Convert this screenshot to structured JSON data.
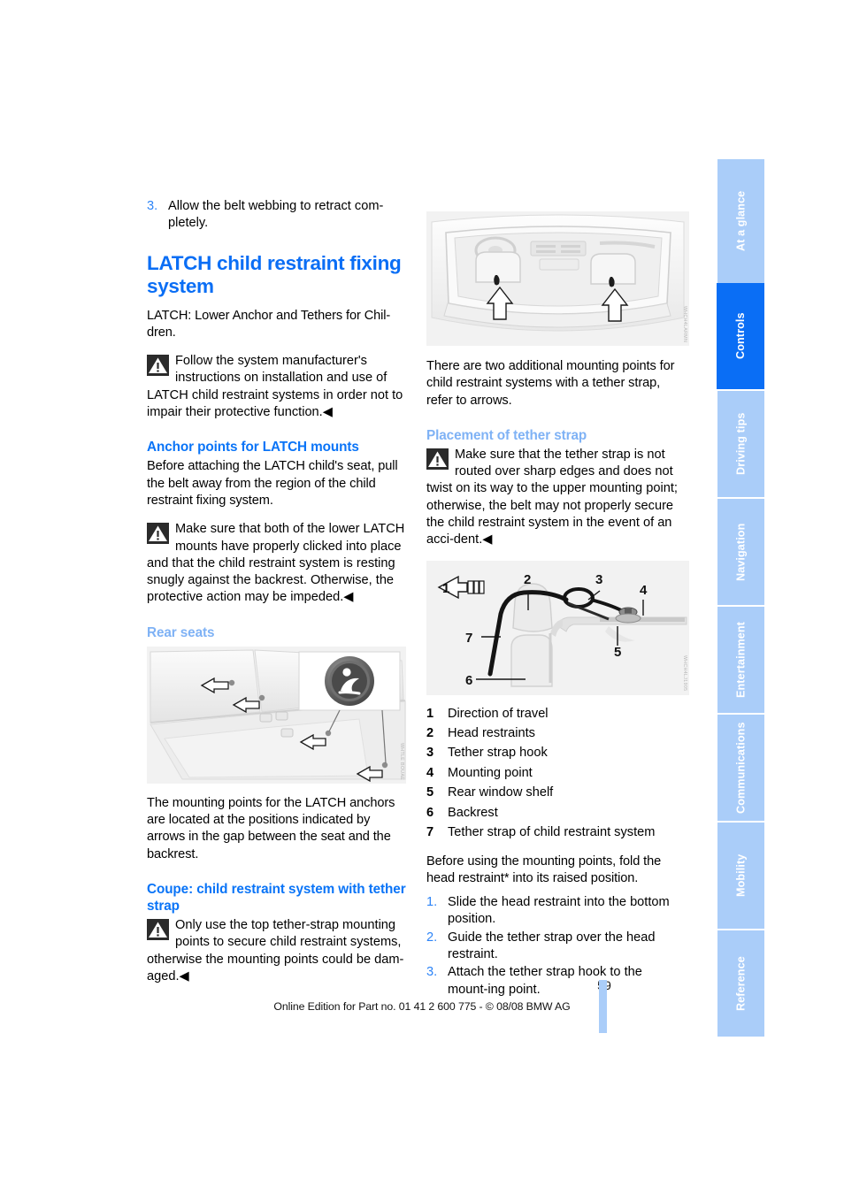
{
  "document": {
    "page_number": "59",
    "footer_text": "Online Edition for Part no. 01 41 2 600 775 - © 08/08 BMW AG"
  },
  "side_tabs": [
    {
      "label": "At a glance",
      "active": false
    },
    {
      "label": "Controls",
      "active": true
    },
    {
      "label": "Driving tips",
      "active": false
    },
    {
      "label": "Navigation",
      "active": false
    },
    {
      "label": "Entertainment",
      "active": false
    },
    {
      "label": "Communications",
      "active": false
    },
    {
      "label": "Mobility",
      "active": false
    },
    {
      "label": "Reference",
      "active": false
    }
  ],
  "colors": {
    "heading_blue": "#0a6ef5",
    "subheading_light_blue": "#7fb2f5",
    "tab_inactive": "#aacdf9",
    "tab_active": "#0a6ef5",
    "figure_background": "#f2f2f2"
  },
  "left_column": {
    "step3": {
      "number": "3.",
      "text": "Allow the belt webbing to retract com-pletely."
    },
    "title": "LATCH child restraint fixing system",
    "intro": "LATCH: Lower Anchor and Tethers for Chil-dren.",
    "warning1": "Follow the system manufacturer's instructions on installation and use of LATCH child restraint systems in order not to impair their protective function.",
    "heading_anchor_points": "Anchor points for LATCH mounts",
    "anchor_para": "Before attaching the LATCH child's seat, pull the belt away from the region of the child restraint fixing system.",
    "warning2": "Make sure that both of the lower LATCH mounts have properly clicked into place and that the child restraint system is resting snugly against the backrest. Otherwise, the protective action may be impeded.",
    "heading_rear_seats": "Rear seats",
    "figure_rear_seats_code": "WHTLE BOUAE",
    "rear_seats_para": "The mounting points for the LATCH anchors are located at the positions indicated by arrows in the gap between the seat and the backrest.",
    "heading_coupe": "Coupe: child restraint system with tether strap",
    "warning3": "Only use the top tether-strap mounting points to secure child restraint systems, otherwise the mounting points could be dam-aged."
  },
  "right_column": {
    "figure_interior_code": "WHCH4LARMN",
    "interior_para": "There are two additional mounting points for child restraint systems with a tether strap, refer to arrows.",
    "heading_placement": "Placement of tether strap",
    "warning4": "Make sure that the tether strap is not routed over sharp edges and does not twist on its way to the upper mounting point; otherwise, the belt may not properly secure the child restraint system in the event of an acci-dent.",
    "figure_tether_code": "WHCH4LJ1905",
    "legend": [
      {
        "num": "1",
        "label": "Direction of travel"
      },
      {
        "num": "2",
        "label": "Head restraints"
      },
      {
        "num": "3",
        "label": "Tether strap hook"
      },
      {
        "num": "4",
        "label": "Mounting point"
      },
      {
        "num": "5",
        "label": "Rear window shelf"
      },
      {
        "num": "6",
        "label": "Backrest"
      },
      {
        "num": "7",
        "label": "Tether strap of child restraint system"
      }
    ],
    "before_using": "Before using the mounting points, fold the head restraint* into its raised position.",
    "steps": [
      {
        "num": "1.",
        "text": "Slide the head restraint into the bottom position."
      },
      {
        "num": "2.",
        "text": "Guide the tether strap over the head restraint."
      },
      {
        "num": "3.",
        "text": "Attach the tether strap hook to the mount-ing point."
      }
    ]
  }
}
